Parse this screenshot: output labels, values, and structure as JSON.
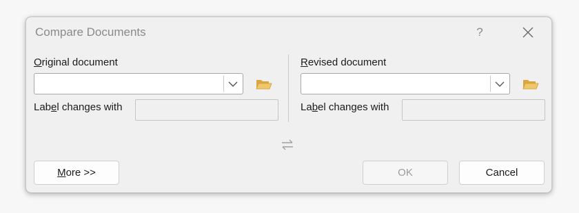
{
  "dialog": {
    "title": "Compare Documents",
    "help_label": "?"
  },
  "original": {
    "label_prefix": "",
    "label_key": "O",
    "label_rest": "riginal document",
    "value": "",
    "changes_label_pre": "Lab",
    "changes_label_key": "e",
    "changes_label_post": "l changes with",
    "changes_value": ""
  },
  "revised": {
    "label_key": "R",
    "label_rest": "evised document",
    "value": "",
    "changes_label_pre": "La",
    "changes_label_key": "b",
    "changes_label_post": "el changes with",
    "changes_value": ""
  },
  "buttons": {
    "more_key": "M",
    "more_rest": "ore >>",
    "ok": "OK",
    "cancel": "Cancel"
  },
  "colors": {
    "folder": "#e8b95a",
    "swap_icon": "#a0a0a0"
  }
}
